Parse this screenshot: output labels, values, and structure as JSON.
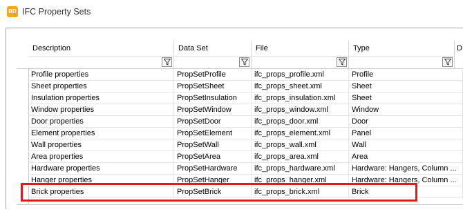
{
  "window": {
    "app_icon": "BD",
    "title": "IFC Property Sets"
  },
  "grid": {
    "columns": [
      {
        "label": "Description"
      },
      {
        "label": "Data Set"
      },
      {
        "label": "File"
      },
      {
        "label": "Type"
      },
      {
        "label": "D"
      }
    ],
    "rows": [
      {
        "description": "Profile properties",
        "data_set": "PropSetProfile",
        "file": "ifc_props_profile.xml",
        "type": "Profile"
      },
      {
        "description": "Sheet properties",
        "data_set": "PropSetSheet",
        "file": "ifc_props_sheet.xml",
        "type": "Sheet"
      },
      {
        "description": "Insulation properties",
        "data_set": "PropSetInsulation",
        "file": "ifc_props_insulation.xml",
        "type": "Sheet"
      },
      {
        "description": "Window properties",
        "data_set": "PropSetWindow",
        "file": "ifc_props_window.xml",
        "type": "Window"
      },
      {
        "description": "Door properties",
        "data_set": "PropSetDoor",
        "file": "ifc_props_door.xml",
        "type": "Door"
      },
      {
        "description": "Element properties",
        "data_set": "PropSetElement",
        "file": "ifc_props_element.xml",
        "type": "Panel"
      },
      {
        "description": "Wall properties",
        "data_set": "PropSetWall",
        "file": "ifc_props_wall.xml",
        "type": "Wall"
      },
      {
        "description": "Area properties",
        "data_set": "PropSetArea",
        "file": "ifc_props_area.xml",
        "type": "Area"
      },
      {
        "description": "Hardware properties",
        "data_set": "PropSetHardware",
        "file": "ifc_props_hardware.xml",
        "type": "Hardware: Hangers, Column ..."
      },
      {
        "description": "Hanger properties",
        "data_set": "PropSetHanger",
        "file": "ifc_props_hanger.xml",
        "type": "Hardware: Hangers, Column ..."
      },
      {
        "description": "Brick properties",
        "data_set": "PropSetBrick",
        "file": "ifc_props_brick.xml",
        "type": "Brick"
      }
    ],
    "highlighted_row": "Brick properties",
    "highlight_color": "#e0191f",
    "icons": {
      "filter": "filter-funnel-icon"
    }
  }
}
